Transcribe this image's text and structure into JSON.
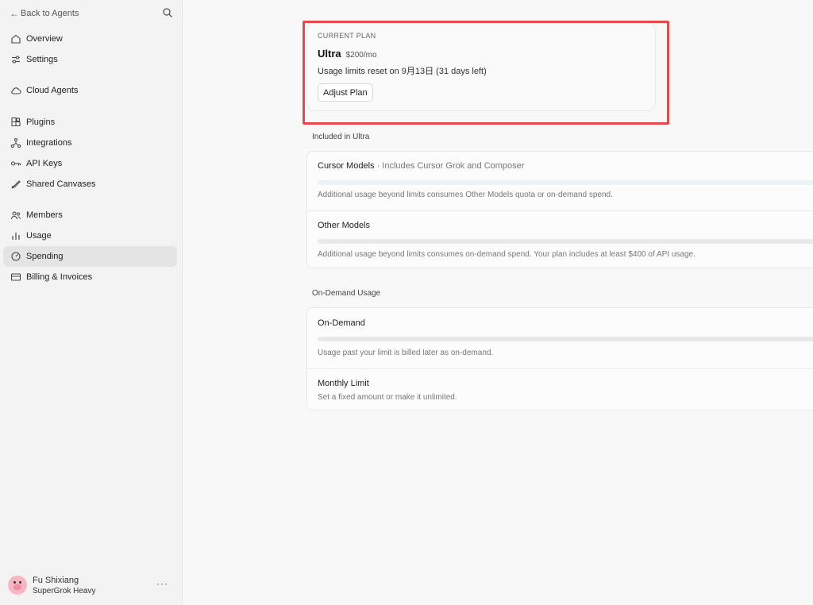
{
  "sidebar": {
    "back_label": "Back to Agents",
    "items": [
      {
        "label": "Overview",
        "icon": "home-icon"
      },
      {
        "label": "Settings",
        "icon": "sliders-icon"
      },
      {
        "label": "Cloud Agents",
        "icon": "cloud-icon"
      },
      {
        "label": "Plugins",
        "icon": "plugin-icon"
      },
      {
        "label": "Integrations",
        "icon": "integrations-icon"
      },
      {
        "label": "API Keys",
        "icon": "key-icon"
      },
      {
        "label": "Shared Canvases",
        "icon": "canvas-icon"
      },
      {
        "label": "Members",
        "icon": "members-icon"
      },
      {
        "label": "Usage",
        "icon": "bar-chart-icon"
      },
      {
        "label": "Spending",
        "icon": "gauge-icon"
      },
      {
        "label": "Billing & Invoices",
        "icon": "card-icon"
      }
    ],
    "active": "Spending",
    "user": {
      "name": "Fu Shixiang",
      "plan": "SuperGrok Heavy",
      "more": "···"
    }
  },
  "current_plan": {
    "eyebrow": "CURRENT PLAN",
    "name": "Ultra",
    "price": "$200/mo",
    "reset_text": "Usage limits reset on 9月13日 (31 days left)",
    "adjust_label": "Adjust Plan"
  },
  "included": {
    "heading": "Included in Ultra",
    "rows": [
      {
        "title": "Cursor Models",
        "subtitle": " · Includes Cursor Grok and Composer",
        "note": "Additional usage beyond limits consumes Other Models quota or on-demand spend."
      },
      {
        "title": "Other Models",
        "subtitle": "",
        "note": "Additional usage beyond limits consumes on-demand spend. Your plan includes at least $400 of API usage."
      }
    ]
  },
  "on_demand": {
    "heading": "On-Demand Usage",
    "rows": [
      {
        "title": "On-Demand",
        "note": "Usage past your limit is billed later as on-demand."
      },
      {
        "title": "Monthly Limit",
        "note": "Set a fixed amount or make it unlimited."
      }
    ]
  },
  "colors": {
    "highlight": "#e8474b",
    "sidebar_bg": "#f3f3f3",
    "active_item": "#e4e4e4"
  }
}
